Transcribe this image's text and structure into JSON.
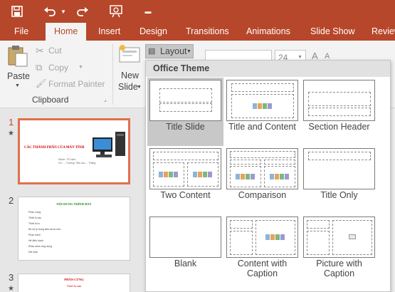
{
  "colors": {
    "accent": "#b7472a",
    "selected_border": "#e0704f"
  },
  "qat": {
    "icons": [
      "save-icon",
      "undo-icon",
      "dropdown-arrow-icon",
      "redo-icon",
      "start-from-beginning-icon",
      "customize-qat-icon"
    ]
  },
  "tabs": [
    "File",
    "Home",
    "Insert",
    "Design",
    "Transitions",
    "Animations",
    "Slide Show",
    "Review"
  ],
  "active_tab": "Home",
  "ribbon": {
    "paste": "Paste",
    "cut": "Cut",
    "copy": "Copy",
    "format_painter": "Format Painter",
    "clipboard_group": "Clipboard",
    "new_slide_1": "New",
    "new_slide_2": "Slide",
    "layout": "Layout",
    "font_size": "24"
  },
  "slides": [
    {
      "number": "1",
      "title": "CÁC THÀNH PHẦN CỦA MÁY TÍNH",
      "subtitle": "Nhóm: Tổ Xanh",
      "subtitle2": "GV: ... Trường: Tiểu học ... Thắng"
    },
    {
      "number": "2",
      "title": "NỘI DUNG TRÌNH BÀY",
      "items": [
        "Phần cứng",
        "Thiết bị vào",
        "Thiết bị ra",
        "Bộ xử lý trung tâm và bộ nhớ",
        "Phần mềm",
        "Hệ điều hành",
        "Phần mềm ứng dụng",
        "Kết luận"
      ]
    },
    {
      "number": "3",
      "title": "PHẦN CỨNG",
      "subtitle": "Thiết bị vào"
    }
  ],
  "layout_menu": {
    "theme": "Office Theme",
    "layouts": [
      {
        "name": "Title Slide"
      },
      {
        "name": "Title and Content"
      },
      {
        "name": "Section Header"
      },
      {
        "name": "Two Content"
      },
      {
        "name": "Comparison"
      },
      {
        "name": "Title Only"
      },
      {
        "name": "Blank"
      },
      {
        "name": "Content with Caption"
      },
      {
        "name": "Picture with Caption"
      }
    ]
  }
}
